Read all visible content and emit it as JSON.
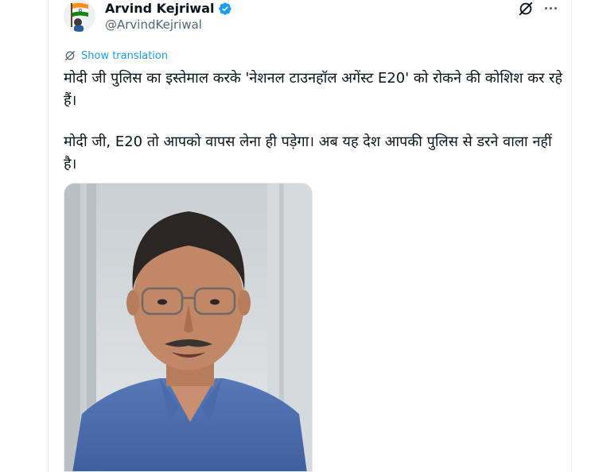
{
  "author": {
    "display_name": "Arvind Kejriwal",
    "handle": "@ArvindKejriwal",
    "verified": true,
    "avatar_icon": "indian-flag-avatar"
  },
  "actions": {
    "grok_icon": "grok-icon",
    "more_icon": "more-horizontal-icon"
  },
  "translate": {
    "icon": "translate-icon",
    "label": "Show translation"
  },
  "tweet": {
    "paragraphs": [
      "मोदी जी पुलिस का इस्तेमाल करके 'नेशनल टाउनहॉल अगेंस्ट E20' को रोकने की कोशिश कर रहे हैं।",
      "मोदी जी, E20 तो आपको वापस लेना ही पड़ेगा। अब यह देश आपकी पुलिस से डरने वाला नहीं है।"
    ]
  },
  "media": {
    "type": "video-still",
    "subject": "man-in-blue-shirt"
  },
  "colors": {
    "link": "#1d9bf0",
    "verified": "#1d9bf0",
    "secondary_text": "#536471",
    "primary_text": "#0f1419"
  }
}
